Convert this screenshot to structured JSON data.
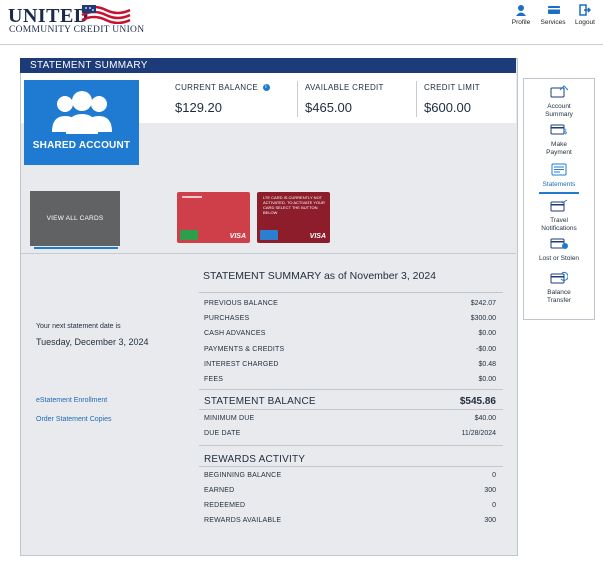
{
  "header": {
    "logo_main": "UNITED",
    "logo_sub": "COMMUNITY CREDIT UNION",
    "buttons": [
      {
        "label": "Profile",
        "icon": "user-icon"
      },
      {
        "label": "Services",
        "icon": "card-icon"
      },
      {
        "label": "Logout",
        "icon": "logout-icon"
      }
    ]
  },
  "panel": {
    "title": "STATEMENT SUMMARY",
    "shared_account_label": "SHARED ACCOUNT",
    "current_balance_label": "CURRENT BALANCE",
    "current_balance": "$129.20",
    "available_credit_label": "AVAILABLE CREDIT",
    "available_credit": "$465.00",
    "credit_limit_label": "CREDIT LIMIT",
    "credit_limit": "$600.00",
    "view_all_cards": "VIEW ALL CARDS",
    "card1_brand": "VISA",
    "card2_brand": "VISA",
    "card2_text": "LTE CARD IS CURRENTLY NOT ACTIVATED. TO ACTIVATE YOUR CARD SELECT THE BUTTON BELOW"
  },
  "left": {
    "next_statement_label": "Your next statement date is",
    "next_statement_date": "Tuesday, December 3, 2024",
    "estatement_link": "eStatement Enrollment",
    "copies_link": "Order Statement Copies"
  },
  "summary": {
    "title": "STATEMENT SUMMARY as of November 3, 2024",
    "rows": [
      {
        "label": "PREVIOUS BALANCE",
        "value": "$242.07"
      },
      {
        "label": "PURCHASES",
        "value": "$300.00"
      },
      {
        "label": "CASH ADVANCES",
        "value": "$0.00"
      },
      {
        "label": "PAYMENTS & CREDITS",
        "value": "-$0.00"
      },
      {
        "label": "INTEREST CHARGED",
        "value": "$0.48"
      },
      {
        "label": "FEES",
        "value": "$0.00"
      }
    ],
    "statement_balance_label": "STATEMENT BALANCE",
    "statement_balance": "$545.86",
    "due_rows": [
      {
        "label": "MINIMUM DUE",
        "value": "$40.00"
      },
      {
        "label": "DUE DATE",
        "value": "11/28/2024"
      }
    ]
  },
  "rewards": {
    "title": "REWARDS ACTIVITY",
    "rows": [
      {
        "label": "BEGINNING BALANCE",
        "value": "0"
      },
      {
        "label": "EARNED",
        "value": "300"
      },
      {
        "label": "REDEEMED",
        "value": "0"
      },
      {
        "label": "REWARDS AVAILABLE",
        "value": "300"
      }
    ]
  },
  "sidenav": {
    "items": [
      {
        "label1": "Account",
        "label2": "Summary",
        "icon": "house-card-icon"
      },
      {
        "label1": "Make",
        "label2": "Payment",
        "icon": "card-dollar-icon"
      },
      {
        "label1": "Statements",
        "label2": "",
        "icon": "statement-icon"
      },
      {
        "label1": "Travel",
        "label2": "Notifications",
        "icon": "travel-card-icon"
      },
      {
        "label1": "Lost or Stolen",
        "label2": "",
        "icon": "card-alert-icon"
      },
      {
        "label1": "Balance",
        "label2": "Transfer",
        "icon": "card-transfer-icon"
      }
    ]
  },
  "colors": {
    "brand_navy": "#1d3b78",
    "accent_blue": "#1f7ad1",
    "link_blue": "#1f6ab5",
    "flag_red": "#c8102e"
  }
}
